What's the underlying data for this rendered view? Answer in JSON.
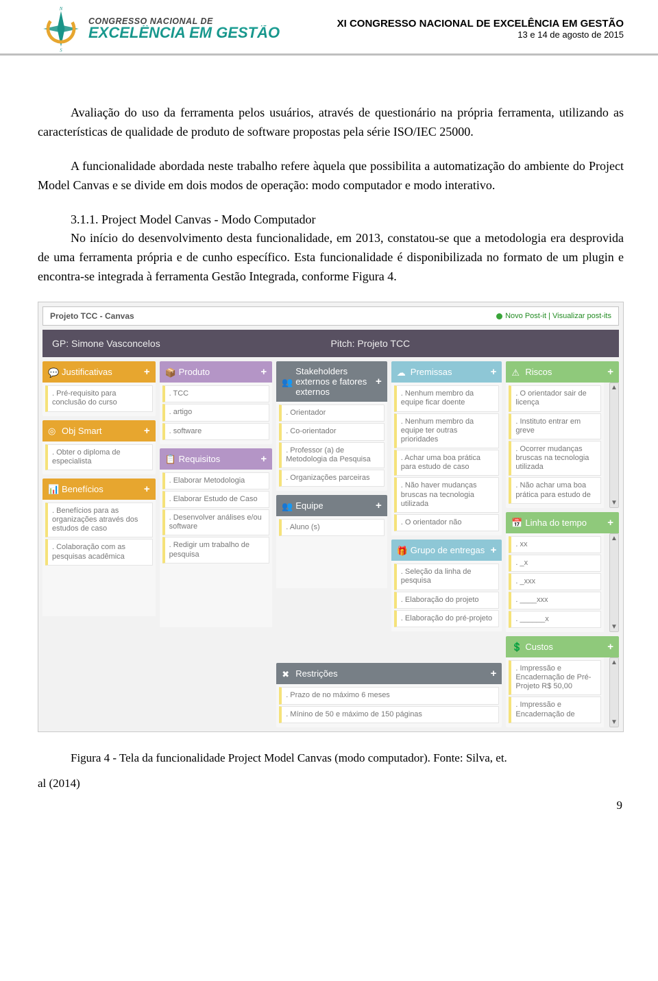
{
  "header": {
    "logo_label_small": "CONGRESSO NACIONAL DE",
    "logo_label_big": "EXCELÊNCIA EM GESTÃO",
    "title_prefix": "XI ",
    "title_bold": "CONGRESSO NACIONAL DE EXCELÊNCIA EM GESTÃO",
    "date": "13 e 14 de agosto de 2015",
    "compass_n": "N",
    "compass_s": "S"
  },
  "body": {
    "p1": "Avaliação do uso da ferramenta pelos usuários, através de questionário na própria ferramenta, utilizando as características de qualidade de produto de software propostas pela série ISO/IEC 25000.",
    "p2": "A funcionalidade abordada neste trabalho refere àquela que possibilita a automatização do ambiente do Project Model Canvas e se divide em dois modos de operação: modo computador e modo interativo.",
    "sec_label": "3.1.1. Project Model Canvas - Modo Computador",
    "p3a": "No início do desenvolvimento desta funcionalidade, em 2013, constatou-se que a metodologia era desprovida de uma ferramenta própria e de cunho específico. Esta funcionalidade é disponibilizada no formato de um plugin e encontra-se integrada à ferramenta Gestão Integrada, conforme Figura 4.",
    "caption": "Figura 4 - Tela da funcionalidade Project Model Canvas (modo computador). Fonte: Silva, et.",
    "caption_src": "al (2014)",
    "page_number": "9"
  },
  "canvas": {
    "frame_title": "Projeto TCC - Canvas",
    "badge": "Novo Post-it | Visualizar post-its",
    "gp_label": "GP: Simone Vasconcelos",
    "pitch_label": "Pitch: Projeto TCC",
    "plus": "+",
    "cols": {
      "justificativas": {
        "title": "Justificativas",
        "notes": [
          ". Pré-requisito para conclusão do curso"
        ]
      },
      "obj": {
        "title": "Obj Smart",
        "notes": [
          ". Obter o diploma de especialista"
        ]
      },
      "beneficios": {
        "title": "Benefícios",
        "notes": [
          ". Benefícios para as organizações através dos estudos de caso",
          ". Colaboração com as pesquisas acadêmica"
        ]
      },
      "produto": {
        "title": "Produto",
        "notes": [
          ". TCC",
          ". artigo",
          ". software"
        ]
      },
      "requisitos": {
        "title": "Requisitos",
        "notes": [
          ". Elaborar Metodologia",
          ". Elaborar Estudo de Caso",
          ". Desenvolver análises e/ou software",
          ". Redigir um trabalho de pesquisa"
        ]
      },
      "stake": {
        "title": "Stakeholders externos e fatores externos",
        "notes": [
          ". Orientador",
          ". Co-orientador",
          ". Professor (a) de Metodologia da Pesquisa",
          ". Organizações parceiras"
        ]
      },
      "equipe": {
        "title": "Equipe",
        "notes": [
          ". Aluno (s)"
        ]
      },
      "restricoes": {
        "title": "Restrições",
        "notes": [
          ". Prazo de no máximo 6 meses",
          ". Mínino de 50 e máximo de 150 páginas"
        ]
      },
      "premissas": {
        "title": "Premissas",
        "notes": [
          ". Nenhum membro da equipe ficar doente",
          ". Nenhum membro da equipe ter outras prioridades",
          ". Achar uma boa prática para estudo de caso",
          ". Não haver mudanças bruscas na tecnologia utilizada",
          ". O orientador não"
        ]
      },
      "grupo": {
        "title": "Grupo de entregas",
        "notes": [
          ". Seleção da linha de pesquisa",
          ". Elaboração do projeto",
          ". Elaboração do pré-projeto"
        ]
      },
      "riscos": {
        "title": "Riscos",
        "notes": [
          ". O orientador sair de licença",
          ". Instituto entrar em greve",
          ". Ocorrer mudanças bruscas na tecnologia utilizada",
          ". Não achar uma boa prática para estudo de"
        ]
      },
      "linha": {
        "title": "Linha do tempo",
        "notes": [
          ". xx",
          ". _x",
          ". _xxx",
          ". ____xxx",
          ". ______x"
        ]
      },
      "custos": {
        "title": "Custos",
        "notes": [
          ". Impressão e Encadernação de Pré-Projeto R$ 50,00",
          ". Impressão e Encadernação de"
        ]
      }
    }
  }
}
